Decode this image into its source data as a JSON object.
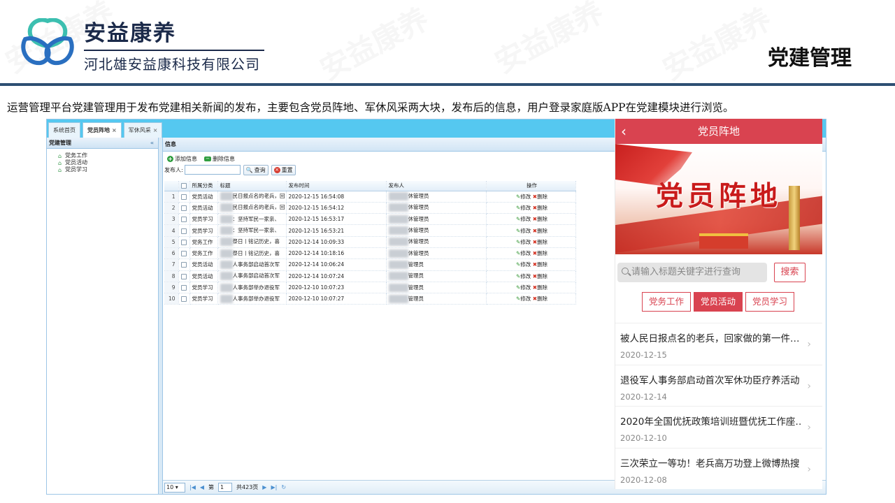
{
  "header": {
    "brand_name": "安益康养",
    "company": "河北雄安益康科技有限公司",
    "page_title": "党建管理",
    "description": "运营管理平台党建管理用于发布党建相关新闻的发布，主要包含党员阵地、军休风采两大块，发布后的信息，用户登录家庭版APP在党建模块进行浏览。"
  },
  "colors": {
    "accent": "#d94350",
    "header_rule": "#2d4f73",
    "admin_tabbar": "#55c8f0"
  },
  "watermark": "安益康养",
  "admin": {
    "tabs": [
      {
        "label": "系统首页",
        "close": ""
      },
      {
        "label": "党员阵地",
        "close": "×"
      },
      {
        "label": "军休风采",
        "close": "×"
      }
    ],
    "sidebar": {
      "title": "党建管理",
      "collapse": "«",
      "items": [
        {
          "label": "党务工作"
        },
        {
          "label": "党员活动"
        },
        {
          "label": "党员学习"
        }
      ]
    },
    "panel_title": "信息",
    "toolbar": {
      "add": "添加信息",
      "delete": "删除信息"
    },
    "filter": {
      "label": "发布人:",
      "search": "查询",
      "reset": "重置"
    },
    "columns": {
      "category": "所属分类",
      "title": "标题",
      "time": "发布时间",
      "publisher": "发布人",
      "ops": "操作"
    },
    "op_edit": "修改",
    "op_delete": "删除",
    "rows": [
      {
        "n": "1",
        "category": "党员活动",
        "title": "民日报点名的老兵，回",
        "time": "2020-12-15 16:54:08",
        "publisher": "休管理员"
      },
      {
        "n": "2",
        "category": "党员活动",
        "title": "民日报点名的老兵，回",
        "time": "2020-12-15 16:54:12",
        "publisher": "休管理员"
      },
      {
        "n": "3",
        "category": "党员学习",
        "title": "：坚持军民一家亲、",
        "time": "2020-12-15 16:53:17",
        "publisher": "休管理员"
      },
      {
        "n": "4",
        "category": "党员学习",
        "title": "：坚持军民一家亲、",
        "time": "2020-12-15 16:53:21",
        "publisher": "休管理员"
      },
      {
        "n": "5",
        "category": "党务工作",
        "title": "祭日丨铭记历史，喜",
        "time": "2020-12-14 10:09:33",
        "publisher": "休管理员"
      },
      {
        "n": "6",
        "category": "党务工作",
        "title": "祭日丨铭记历史，喜",
        "time": "2020-12-14 10:18:16",
        "publisher": "休管理员"
      },
      {
        "n": "7",
        "category": "党员活动",
        "title": "人事务部启动首次军",
        "time": "2020-12-14 10:06:24",
        "publisher": "管理员"
      },
      {
        "n": "8",
        "category": "党员活动",
        "title": "人事务部启动首次军",
        "time": "2020-12-14 10:07:24",
        "publisher": "管理员"
      },
      {
        "n": "9",
        "category": "党员学习",
        "title": "人事务部举办退役军",
        "time": "2020-12-10 10:07:23",
        "publisher": "管理员"
      },
      {
        "n": "10",
        "category": "党员学习",
        "title": "人事务部举办退役军",
        "time": "2020-12-10 10:07:27",
        "publisher": "管理员"
      }
    ],
    "pager": {
      "page_size": "10",
      "page_prefix": "第",
      "page": "1",
      "total_pages": "共423页"
    }
  },
  "app": {
    "title": "党员阵地",
    "back": "‹",
    "banner_text": "党员阵地",
    "search_placeholder": "请输入标题关键字进行查询",
    "search_button": "搜索",
    "categories": [
      {
        "label": "党务工作"
      },
      {
        "label": "党员活动"
      },
      {
        "label": "党员学习"
      }
    ],
    "active_category": "党员活动",
    "news": [
      {
        "title": "被人民日报点名的老兵，回家做的第一件…",
        "date": "2020-12-15"
      },
      {
        "title": "退役军人事务部启动首次军休功臣疗养活动",
        "date": "2020-12-14"
      },
      {
        "title": "2020年全国优抚政策培训班暨优抚工作座…",
        "date": "2020-12-10"
      },
      {
        "title": "三次荣立一等功！老兵高万功登上微博热搜",
        "date": "2020-12-08"
      }
    ]
  }
}
